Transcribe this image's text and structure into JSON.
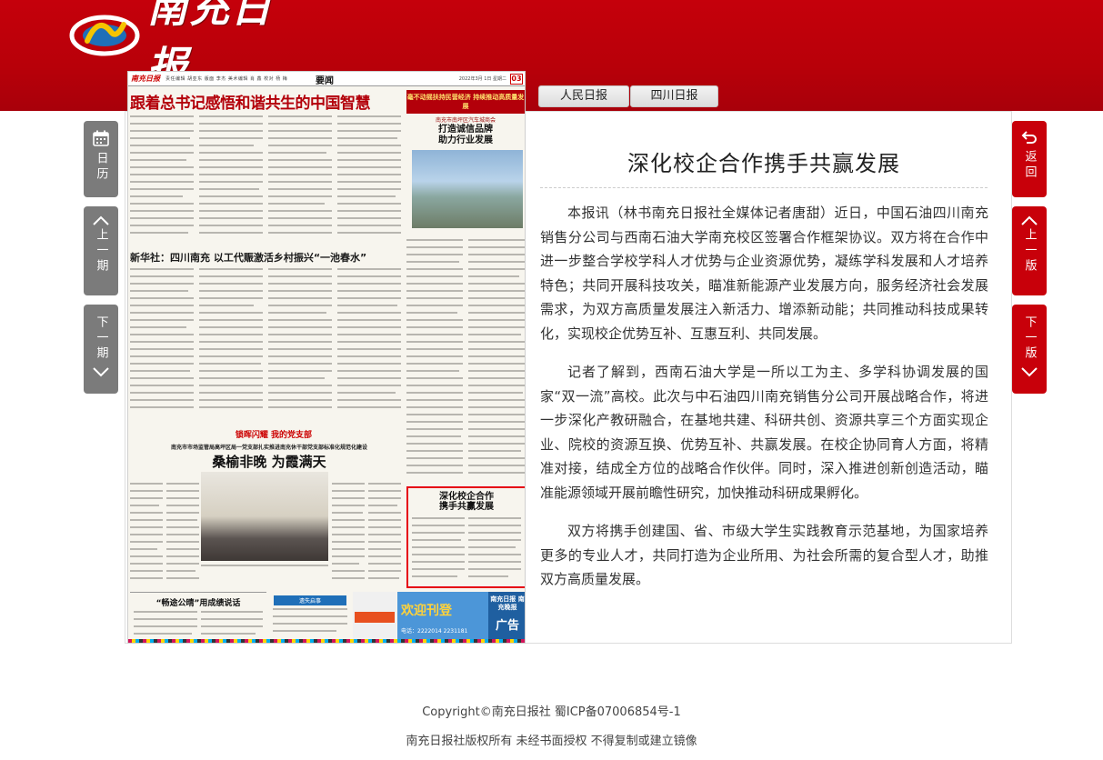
{
  "header": {
    "logo_text": "南充日报",
    "brand_color": "#c5000b"
  },
  "newspaper": {
    "section": "要闻",
    "page_number": "03",
    "masthead": "南充日报",
    "nav_text": "责任编辑 胡亚东 版面 李杰 美术编辑 肖 鑫 校对 杨 梅",
    "date_text": "2022年3月 1日 星期二",
    "headline": "跟着总书记感悟和谐共生的中国智慧",
    "red_band": "毫不动摇扶持民营经济 持续推动高质量发展",
    "ad_org": "南充市南坪区汽车城商会",
    "ad_headline_1": "打造诚信品牌",
    "ad_headline_2": "助力行业发展",
    "sub_headline": "新华社：四川南充  以工代赈激活乡村振兴“一池春水”",
    "banner2": "锁晖闪耀  我的党支部",
    "sub3": "南充市市场监管局高坪区局一党支部扎实推进南充休干部党支部标准化规范化建设",
    "headline3": "桑榆非晚  为霞满天",
    "highlight_title_1": "深化校企合作",
    "highlight_title_2": "携手共赢发展",
    "bottom_left_title": "“畅途公晴”用成绩说话",
    "bottom_mid_title": "遗失启事",
    "ad2_text": "欢迎刊登",
    "ad2_phone": "电话：2222014  2231181",
    "ad2_r1": "南充日报 南充晚报",
    "ad2_r2": "广告"
  },
  "tabs": [
    {
      "label": "人民日报"
    },
    {
      "label": "四川日报"
    }
  ],
  "article": {
    "title": "深化校企合作携手共赢发展",
    "paragraphs": [
      "本报讯（林书南充日报社全媒体记者唐甜）近日，中国石油四川南充销售分公司与西南石油大学南充校区签署合作框架协议。双方将在合作中进一步整合学校学科人才优势与企业资源优势，凝练学科发展和人才培养特色；共同开展科技攻关，瞄准新能源产业发展方向，服务经济社会发展需求，为双方高质量发展注入新活力、增添新动能；共同推动科技成果转化，实现校企优势互补、互惠互利、共同发展。",
      "记者了解到，西南石油大学是一所以工为主、多学科协调发展的国家“双一流”高校。此次与中石油四川南充销售分公司开展战略合作，将进一步深化产教研融合，在基地共建、科研共创、资源共享三个方面实现企业、院校的资源互换、优势互补、共赢发展。在校企协同育人方面，将精准对接，结成全方位的战略合作伙伴。同时，深入推进创新创造活动，瞄准能源领域开展前瞻性研究，加快推动科研成果孵化。",
      "双方将携手创建国、省、市级大学生实践教育示范基地，为国家培养更多的专业人才，共同打造为企业所用、为社会所需的复合型人才，助推双方高质量发展。"
    ]
  },
  "side": {
    "calendar": "日历",
    "prev_issue": "上一期",
    "next_issue": "下一期",
    "back": "返回",
    "prev_edition": "上一版",
    "next_edition": "下一版"
  },
  "footer": {
    "line1": "Copyright©南充日报社  蜀ICP备07006854号-1",
    "line2": "南充日报社版权所有  未经书面授权  不得复制或建立镜像"
  }
}
